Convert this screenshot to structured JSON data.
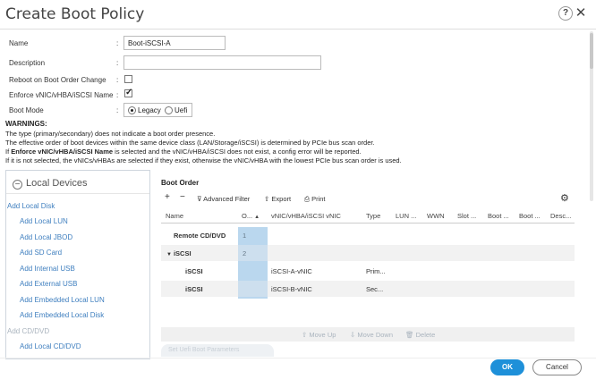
{
  "dialog": {
    "title": "Create Boot Policy",
    "help_glyph": "?",
    "close_glyph": "✕"
  },
  "form": {
    "name_label": "Name",
    "name_value": "Boot-iSCSI-A",
    "description_label": "Description",
    "description_value": "",
    "reboot_label": "Reboot on Boot Order Change",
    "reboot_checked": false,
    "enforce_label": "Enforce vNIC/vHBA/iSCSI Name",
    "enforce_checked": true,
    "boot_mode_label": "Boot Mode",
    "boot_mode_options": [
      "Legacy",
      "Uefi"
    ],
    "boot_mode_selected": "Legacy",
    "colon": ":"
  },
  "warnings": {
    "title": "WARNINGS:",
    "line1": "The type (primary/secondary) does not indicate a boot order presence.",
    "line2": "The effective order of boot devices within the same device class (LAN/Storage/iSCSI) is determined by PCIe bus scan order.",
    "line3_prefix": "If ",
    "line3_bold": "Enforce vNIC/vHBA/iSCSI Name",
    "line3_suffix": " is selected and the vNIC/vHBA/iSCSI does not exist, a config error will be reported.",
    "line4": "If it is not selected, the vNICs/vHBAs are selected if they exist, otherwise the vNIC/vHBA with the lowest PCIe bus scan order is used."
  },
  "local_devices": {
    "header": "Local Devices",
    "items": [
      {
        "label": "Add Local Disk",
        "disabled": false
      },
      {
        "label": "Add Local LUN",
        "disabled": false
      },
      {
        "label": "Add Local JBOD",
        "disabled": false
      },
      {
        "label": "Add SD Card",
        "disabled": false
      },
      {
        "label": "Add Internal USB",
        "disabled": false
      },
      {
        "label": "Add External USB",
        "disabled": false
      },
      {
        "label": "Add Embedded Local LUN",
        "disabled": false
      },
      {
        "label": "Add Embedded Local Disk",
        "disabled": false
      },
      {
        "label": "Add CD/DVD",
        "disabled": true
      },
      {
        "label": "Add Local CD/DVD",
        "disabled": false
      }
    ]
  },
  "boot_order": {
    "title": "Boot Order",
    "toolbar": {
      "add": "+",
      "remove": "−",
      "filter": "Advanced Filter",
      "export": "Export",
      "print": "Print"
    },
    "columns": [
      "Name",
      "O...",
      "vNIC/vHBA/iSCSI vNIC",
      "Type",
      "LUN ...",
      "WWN",
      "Slot ...",
      "Boot ...",
      "Boot ...",
      "Desc..."
    ],
    "rows": [
      {
        "name": "Remote CD/DVD",
        "order": "1",
        "vnic": "",
        "type": ""
      },
      {
        "name": "iSCSI",
        "order": "2",
        "vnic": "",
        "type": ""
      },
      {
        "name": "iSCSI",
        "order": "",
        "vnic": "iSCSI-A-vNIC",
        "type": "Prim..."
      },
      {
        "name": "iSCSI",
        "order": "",
        "vnic": "iSCSI-B-vNIC",
        "type": "Sec..."
      }
    ],
    "bottom": {
      "move_up": "Move Up",
      "move_down": "Move Down",
      "delete": "Delete",
      "set_uefi": "Set Uefi Boot Parameters"
    }
  },
  "footer": {
    "ok": "OK",
    "cancel": "Cancel"
  }
}
